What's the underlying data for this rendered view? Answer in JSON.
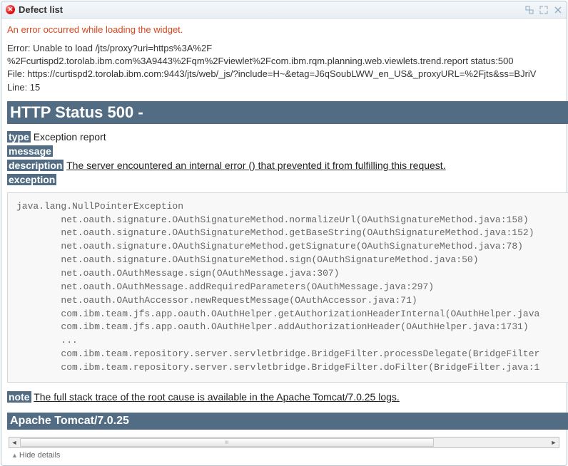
{
  "title": "Defect list",
  "error_summary": "An error occurred while loading the widget.",
  "error_detail": "Error: Unable to load /jts/proxy?uri=https%3A%2F\n%2Fcurtispd2.torolab.ibm.com%3A9443%2Fqm%2Fviewlet%2Fcom.ibm.rqm.planning.web.viewlets.trend.report status:500\nFile: https://curtispd2.torolab.ibm.com:9443/jts/web/_js/?include=H~&etag=J6qSoubLWW_en_US&_proxyURL=%2Fjts&ss=BJriV\nLine: 15",
  "http_status": "HTTP Status 500 -",
  "report": {
    "type_label": "type",
    "type_value": "Exception report",
    "message_label": "message",
    "description_label": "description",
    "description_value": "The server encountered an internal error () that prevented it from fulfilling this request.",
    "exception_label": "exception",
    "note_label": "note",
    "note_value": "The full stack trace of the root cause is available in the Apache Tomcat/7.0.25 logs."
  },
  "stack_trace": "java.lang.NullPointerException\n        net.oauth.signature.OAuthSignatureMethod.normalizeUrl(OAuthSignatureMethod.java:158)\n        net.oauth.signature.OAuthSignatureMethod.getBaseString(OAuthSignatureMethod.java:152)\n        net.oauth.signature.OAuthSignatureMethod.getSignature(OAuthSignatureMethod.java:78)\n        net.oauth.signature.OAuthSignatureMethod.sign(OAuthSignatureMethod.java:50)\n        net.oauth.OAuthMessage.sign(OAuthMessage.java:307)\n        net.oauth.OAuthMessage.addRequiredParameters(OAuthMessage.java:297)\n        net.oauth.OAuthAccessor.newRequestMessage(OAuthAccessor.java:71)\n        com.ibm.team.jfs.app.oauth.OAuthHelper.getAuthorizationHeaderInternal(OAuthHelper.java\n        com.ibm.team.jfs.app.oauth.OAuthHelper.addAuthorizationHeader(OAuthHelper.java:1731)\n        ...\n        com.ibm.team.repository.server.servletbridge.BridgeFilter.processDelegate(BridgeFilter\n        com.ibm.team.repository.server.servletbridge.BridgeFilter.doFilter(BridgeFilter.java:1",
  "footer_banner": "Apache Tomcat/7.0.25",
  "hide_details": "Hide details"
}
